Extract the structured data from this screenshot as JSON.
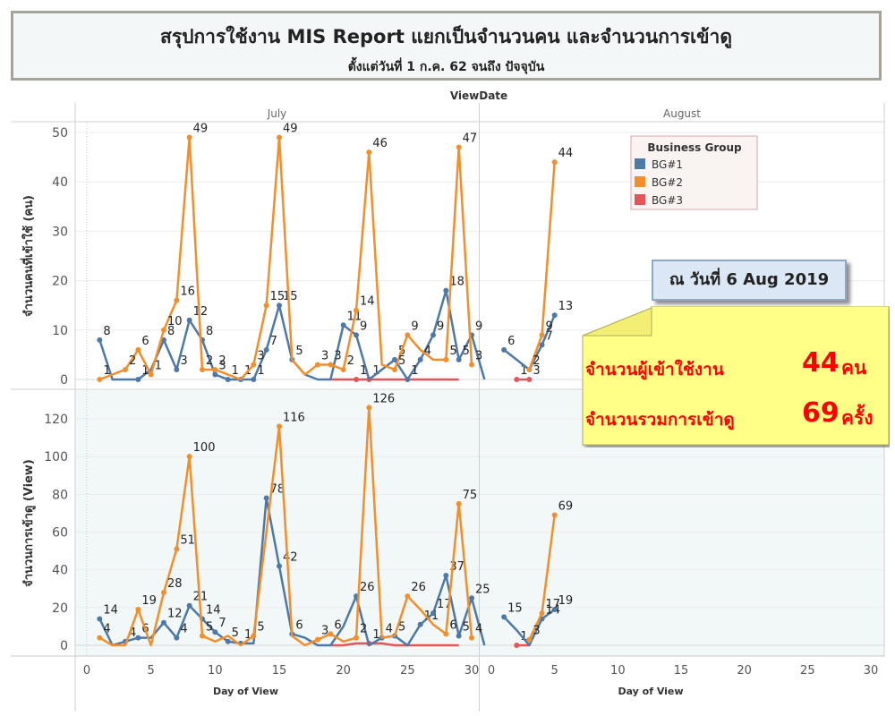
{
  "header": {
    "title": "สรุปการใช้งาน MIS Report แยกเป็นจำนวนคน และจำนวนการเข้าดู",
    "subtitle": "ตั้งแต่วันที่ 1 ก.ค. 62 จนถึง ปัจจุบัน"
  },
  "annotation": {
    "date_label": "ณ วันที่ 6 Aug 2019",
    "users_label": "จำนวนผู้เข้าใช้งาน",
    "users_value": "44",
    "users_unit": "คน",
    "views_label": "จำนวนรวมการเข้าดู",
    "views_value": "69",
    "views_unit": "ครั้ง",
    "colors": {
      "callout_fill": "#ffff88",
      "callout_text": "#ff0000",
      "date_box_fill": "#dbe7f4"
    }
  },
  "colors": {
    "BG#1": "#4e79a7",
    "BG#2": "#f28e2b",
    "BG#3": "#e15759",
    "bottom_pane_bg": "#f2f8f8"
  },
  "chart_data": {
    "type": "line",
    "column_header": "ViewDate",
    "columns": [
      "July",
      "August"
    ],
    "xlabel": "Day of View",
    "xlim": [
      0,
      31
    ],
    "xticks": [
      0,
      5,
      10,
      15,
      20,
      25,
      30
    ],
    "legend": {
      "title": "Business Group",
      "entries": [
        "BG#1",
        "BG#2",
        "BG#3"
      ],
      "placement": "top-right"
    },
    "rows": [
      {
        "ylabel": "จำนวนคนที่เข้าใช้ (คน)",
        "ylim": [
          0,
          52
        ],
        "yticks": [
          0,
          10,
          20,
          30,
          40,
          50
        ],
        "panels": [
          {
            "column": "July",
            "series": [
              {
                "name": "BG#1",
                "x": [
                  1,
                  2,
                  3,
                  4,
                  5,
                  6,
                  7,
                  8,
                  9,
                  10,
                  11,
                  12,
                  13,
                  14,
                  15,
                  16,
                  17,
                  18,
                  19,
                  20,
                  21,
                  22,
                  23,
                  24,
                  25,
                  26,
                  27,
                  28,
                  29,
                  30,
                  31
                ],
                "y": [
                  8,
                  0,
                  0,
                  0,
                  2,
                  8,
                  2,
                  12,
                  8,
                  1,
                  0,
                  0,
                  0,
                  6,
                  15,
                  4,
                  1,
                  0,
                  0,
                  11,
                  9,
                  0,
                  2,
                  4,
                  0,
                  4,
                  9,
                  18,
                  4,
                  9,
                  0
                ],
                "labels": {
                  "1": "8",
                  "4": "1",
                  "6": "8",
                  "7": "3",
                  "8": "12",
                  "9": "8",
                  "10": "3",
                  "11": "1",
                  "12": "1",
                  "13": "1",
                  "14": "7",
                  "15": "15",
                  "16": "5",
                  "20": "11",
                  "21": "9",
                  "24": "5",
                  "25": "1",
                  "26": "4",
                  "27": "9",
                  "28": "18",
                  "29": "5",
                  "30": "9"
                }
              },
              {
                "name": "BG#2",
                "x": [
                  1,
                  2,
                  3,
                  4,
                  5,
                  6,
                  7,
                  8,
                  9,
                  10,
                  11,
                  12,
                  13,
                  14,
                  15,
                  16,
                  17,
                  18,
                  19,
                  20,
                  21,
                  22,
                  23,
                  24,
                  25,
                  26,
                  27,
                  28,
                  29,
                  30
                ],
                "y": [
                  0,
                  1,
                  2,
                  6,
                  1,
                  10,
                  16,
                  49,
                  2,
                  2,
                  1,
                  0,
                  3,
                  15,
                  49,
                  4,
                  1,
                  3,
                  3,
                  2,
                  14,
                  46,
                  3,
                  2,
                  9,
                  6,
                  4,
                  4,
                  47,
                  3
                ],
                "labels": {
                  "1": "1",
                  "3": "2",
                  "4": "6",
                  "5": "1",
                  "6": "10",
                  "7": "16",
                  "8": "49",
                  "9": "2",
                  "10": "2",
                  "13": "3",
                  "14": "15",
                  "15": "49",
                  "18": "3",
                  "19": "3",
                  "20": "2",
                  "21": "14",
                  "22": "46",
                  "24": "5",
                  "25": "9",
                  "28": "5",
                  "29": "47",
                  "30": "3"
                }
              },
              {
                "name": "BG#3",
                "x": [
                  19,
                  20,
                  21,
                  22,
                  23,
                  24,
                  25,
                  26,
                  27,
                  28,
                  29
                ],
                "y": [
                  0,
                  0,
                  0,
                  0,
                  0,
                  0,
                  0,
                  0,
                  0,
                  0,
                  0
                ],
                "labels": {
                  "21": "1",
                  "22": "1"
                }
              }
            ]
          },
          {
            "column": "August",
            "series": [
              {
                "name": "BG#1",
                "x": [
                  1,
                  2,
                  3,
                  4,
                  5
                ],
                "y": [
                  6,
                  4,
                  2,
                  7,
                  13
                ],
                "labels": {
                  "1": "6",
                  "4": "7",
                  "5": "13"
                }
              },
              {
                "name": "BG#2",
                "x": [
                  3,
                  4,
                  5
                ],
                "y": [
                  2,
                  9,
                  44
                ],
                "labels": {
                  "3": "2",
                  "4": "9",
                  "5": "44"
                }
              },
              {
                "name": "BG#3",
                "x": [
                  2,
                  3
                ],
                "y": [
                  0,
                  0
                ],
                "labels": {
                  "2": "1",
                  "3": "3"
                }
              }
            ]
          }
        ]
      },
      {
        "ylabel": "จำนวนการเข้าดู (View)",
        "ylim": [
          0,
          128
        ],
        "yticks": [
          0,
          20,
          40,
          60,
          80,
          100,
          120
        ],
        "panels": [
          {
            "column": "July",
            "series": [
              {
                "name": "BG#1",
                "x": [
                  1,
                  2,
                  3,
                  4,
                  5,
                  6,
                  7,
                  8,
                  9,
                  10,
                  11,
                  12,
                  13,
                  14,
                  15,
                  16,
                  17,
                  18,
                  19,
                  20,
                  21,
                  22,
                  23,
                  24,
                  25,
                  26,
                  27,
                  28,
                  29,
                  30,
                  31
                ],
                "y": [
                  14,
                  0,
                  2,
                  4,
                  4,
                  12,
                  4,
                  21,
                  14,
                  7,
                  2,
                  1,
                  1,
                  78,
                  42,
                  6,
                  4,
                  0,
                  0,
                  10,
                  26,
                  0,
                  4,
                  5,
                  0,
                  11,
                  17,
                  37,
                  5,
                  25,
                  0
                ],
                "labels": {
                  "1": "14",
                  "3": "4",
                  "4": "6",
                  "6": "12",
                  "7": "4",
                  "8": "21",
                  "9": "14",
                  "10": "7",
                  "11": "5",
                  "12": "1",
                  "14": "78",
                  "15": "42",
                  "16": "6",
                  "21": "26",
                  "23": "4",
                  "24": "5",
                  "26": "11",
                  "27": "17",
                  "28": "37",
                  "29": "5",
                  "30": "25"
                }
              },
              {
                "name": "BG#2",
                "x": [
                  1,
                  2,
                  3,
                  4,
                  5,
                  6,
                  7,
                  8,
                  9,
                  10,
                  11,
                  12,
                  13,
                  14,
                  15,
                  16,
                  17,
                  18,
                  19,
                  20,
                  21,
                  22,
                  23,
                  24,
                  25,
                  26,
                  27,
                  28,
                  29,
                  30
                ],
                "y": [
                  4,
                  0,
                  0,
                  19,
                  0,
                  28,
                  51,
                  100,
                  5,
                  2,
                  5,
                  0,
                  5,
                  60,
                  116,
                  5,
                  0,
                  3,
                  6,
                  2,
                  4,
                  126,
                  4,
                  5,
                  26,
                  19,
                  11,
                  6,
                  75,
                  4
                ],
                "labels": {
                  "1": "4",
                  "4": "19",
                  "6": "28",
                  "7": "51",
                  "8": "100",
                  "9": "5",
                  "13": "5",
                  "15": "116",
                  "18": "3",
                  "19": "6",
                  "21": "2",
                  "22": "126",
                  "25": "26",
                  "28": "6",
                  "29": "75",
                  "30": "4"
                }
              },
              {
                "name": "BG#3",
                "x": [
                  19,
                  20,
                  21,
                  22,
                  23,
                  24,
                  25,
                  26,
                  27,
                  28,
                  29
                ],
                "y": [
                  0,
                  0,
                  1,
                  1,
                  1,
                  0,
                  0,
                  0,
                  0,
                  0,
                  0
                ],
                "labels": {
                  "22": "1"
                }
              }
            ]
          },
          {
            "column": "August",
            "series": [
              {
                "name": "BG#1",
                "x": [
                  1,
                  2,
                  3,
                  4,
                  5
                ],
                "y": [
                  15,
                  8,
                  0,
                  14,
                  19
                ],
                "labels": {
                  "1": "15",
                  "4": "14",
                  "5": "19"
                }
              },
              {
                "name": "BG#2",
                "x": [
                  3,
                  4,
                  5
                ],
                "y": [
                  3,
                  17,
                  69
                ],
                "labels": {
                  "3": "3",
                  "4": "17",
                  "5": "69"
                }
              },
              {
                "name": "BG#3",
                "x": [
                  2,
                  3
                ],
                "y": [
                  0,
                  0
                ],
                "labels": {
                  "2": "1"
                }
              }
            ]
          }
        ]
      }
    ]
  }
}
